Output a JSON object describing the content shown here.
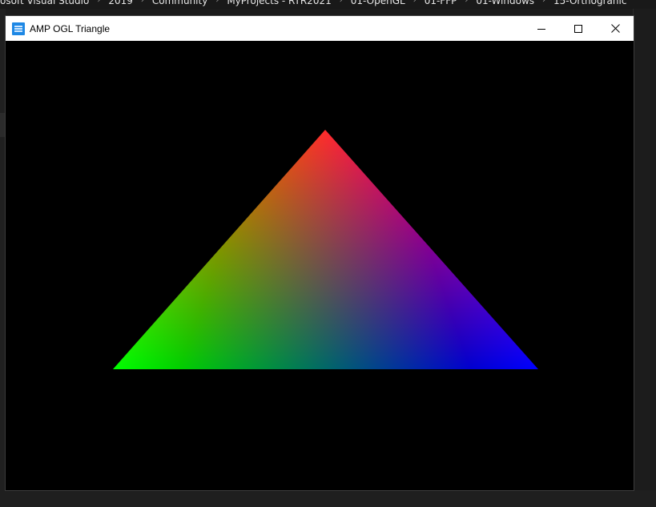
{
  "background": {
    "breadcrumbs": [
      "osoft Visual Studio",
      "2019",
      "Community",
      "MyProjects - RTR2021",
      "01-OpenGL",
      "01-FFP",
      "01-Windows",
      "15-Orthograhic"
    ]
  },
  "window": {
    "title": "AMP OGL Triangle",
    "icon": "app-window-icon",
    "controls": {
      "minimize": "minimize-icon",
      "maximize": "maximize-icon",
      "close": "close-icon"
    }
  },
  "scene": {
    "background_color": "#000000",
    "triangle": {
      "top_color": "#ff0000",
      "left_color": "#00ff00",
      "right_color": "#0000ff"
    }
  }
}
